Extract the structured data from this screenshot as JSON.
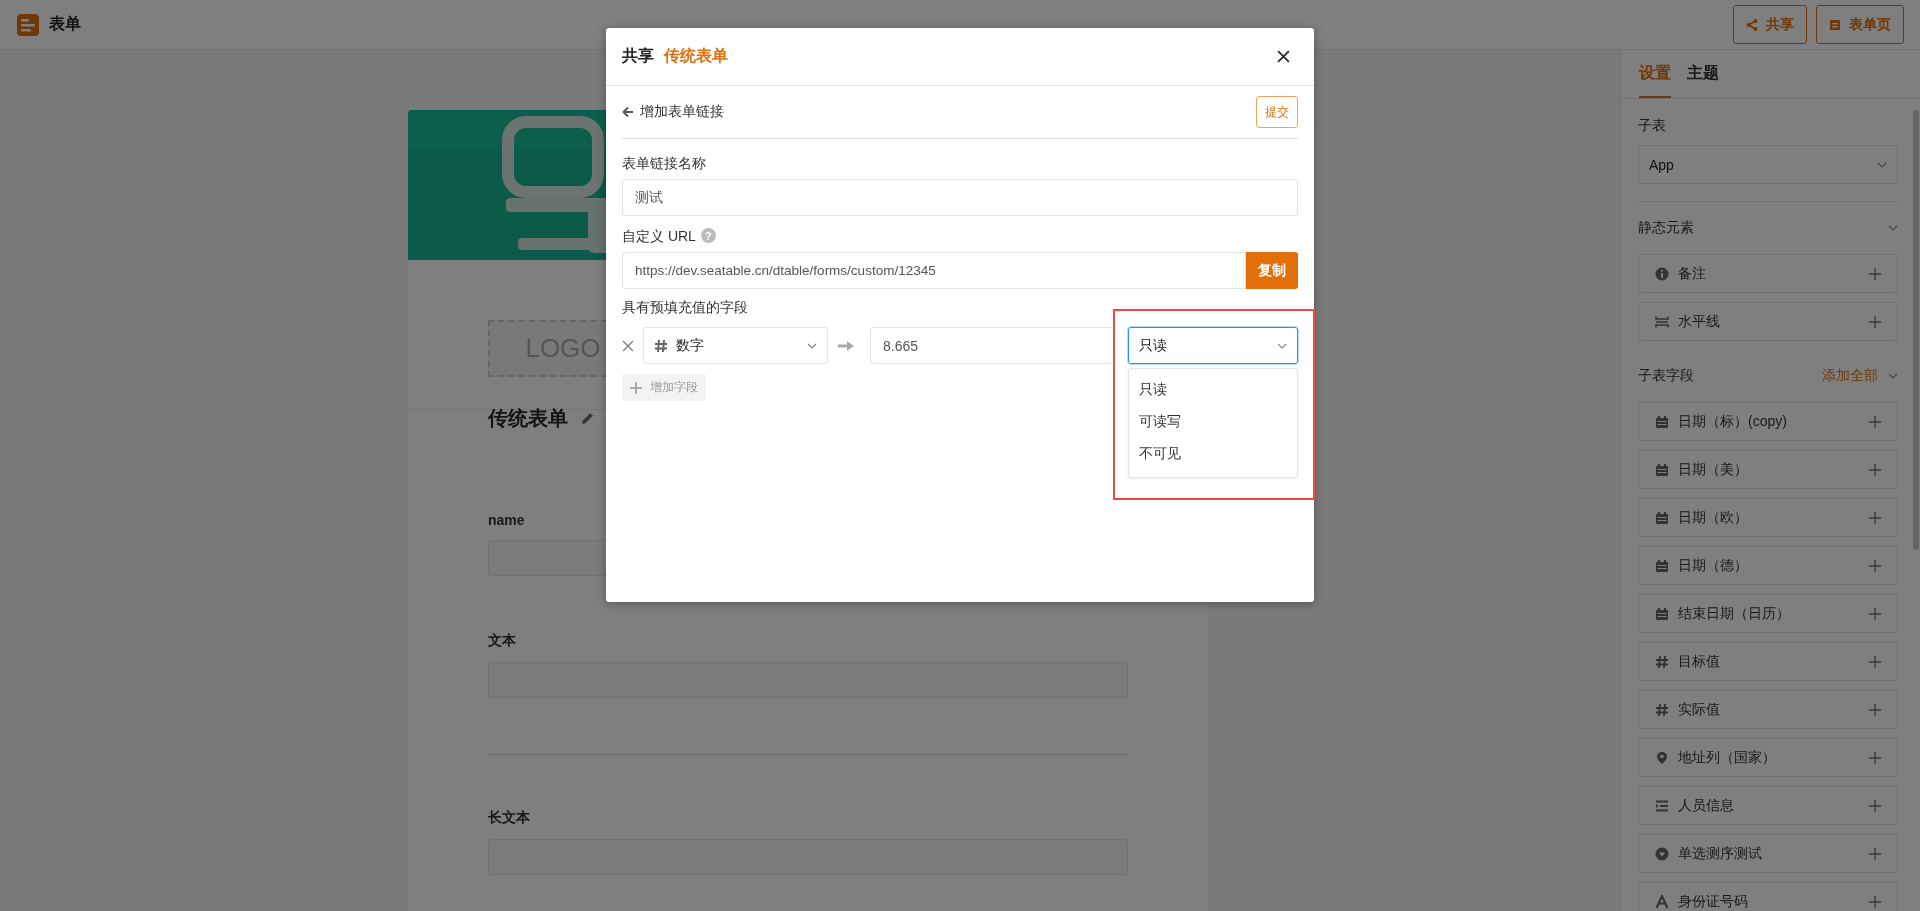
{
  "header": {
    "title": "表单",
    "buttons": [
      {
        "label": "共享",
        "kind": "share"
      },
      {
        "label": "表单页",
        "kind": "page"
      }
    ]
  },
  "form": {
    "logo": "LOGO",
    "title": "传统表单",
    "fields": [
      {
        "kind": "input",
        "label": "name"
      },
      {
        "kind": "input",
        "label": "文本"
      },
      {
        "kind": "divider"
      },
      {
        "kind": "input",
        "label": "长文本"
      }
    ]
  },
  "sidebar": {
    "tabs": [
      {
        "label": "设置",
        "selected": true
      },
      {
        "label": "主题",
        "selected": false
      }
    ],
    "subtable": {
      "label": "子表",
      "value": "App"
    },
    "static_section": {
      "title": "静态元素",
      "items": [
        {
          "label": "备注",
          "kind": "info"
        },
        {
          "label": "水平线",
          "kind": "hline"
        }
      ]
    },
    "fields_section": {
      "title": "子表字段",
      "action": "添加全部",
      "items": [
        {
          "label": "日期（标）(copy)",
          "kind": "date"
        },
        {
          "label": "日期（美）",
          "kind": "date"
        },
        {
          "label": "日期（欧）",
          "kind": "date"
        },
        {
          "label": "日期（德）",
          "kind": "date"
        },
        {
          "label": "结束日期（日历）",
          "kind": "date"
        },
        {
          "label": "目标值",
          "kind": "number"
        },
        {
          "label": "实际值",
          "kind": "number"
        },
        {
          "label": "地址列（国家）",
          "kind": "location"
        },
        {
          "label": "人员信息",
          "kind": "list"
        },
        {
          "label": "单选测序测试",
          "kind": "single-select"
        },
        {
          "label": "身份证号码",
          "kind": "text"
        }
      ]
    }
  },
  "dialog": {
    "title": "共享",
    "form_name": "传统表单",
    "back_label": "增加表单链接",
    "submit": "提交",
    "name_label": "表单链接名称",
    "name_value": "测试",
    "url_label": "自定义 URL",
    "url_help": "?",
    "url_value": "https://dev.seatable.cn/dtable/forms/custom/12345",
    "copy": "复制",
    "prefill_label": "具有预填充值的字段",
    "prefill_rows": [
      {
        "field": "数字",
        "kind": "number",
        "value": "8.665",
        "mode": "只读",
        "menu_open": true
      }
    ],
    "mode_options": [
      "只读",
      "可读写",
      "不可见"
    ],
    "add_field": "增加字段"
  }
}
